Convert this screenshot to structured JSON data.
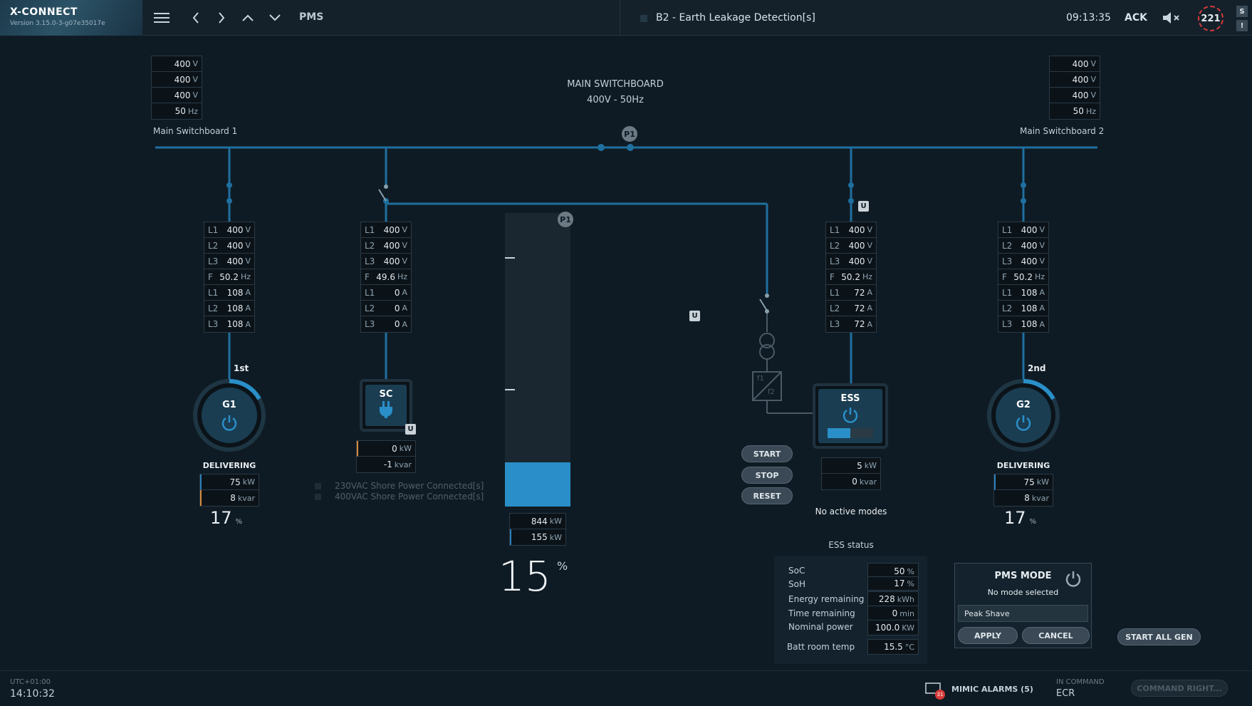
{
  "header": {
    "brand": "X-CONNECT",
    "version": "Version 3.15.0-3-g07e35017e",
    "page_title": "PMS",
    "alarm_text": "B2 - Earth Leakage Detection[s]",
    "alarm_time": "09:13:35",
    "ack_label": "ACK",
    "alarm_count": "221",
    "side_tags": [
      "S",
      "!"
    ]
  },
  "switchboard": {
    "title": "MAIN SWITCHBOARD",
    "subtitle": "400V - 50Hz",
    "left_label": "Main Switchboard 1",
    "right_label": "Main Switchboard 2",
    "bus_badge": "P1",
    "left_values": [
      [
        "400",
        "V"
      ],
      [
        "400",
        "V"
      ],
      [
        "400",
        "V"
      ],
      [
        "50",
        "Hz"
      ]
    ],
    "right_values": [
      [
        "400",
        "V"
      ],
      [
        "400",
        "V"
      ],
      [
        "400",
        "V"
      ],
      [
        "50",
        "Hz"
      ]
    ]
  },
  "g1": {
    "name": "G1",
    "rank": "1st",
    "state": "DELIVERING",
    "meas": [
      [
        "L1",
        "400",
        "V"
      ],
      [
        "L2",
        "400",
        "V"
      ],
      [
        "L3",
        "400",
        "V"
      ],
      [
        "F",
        "50.2",
        "Hz"
      ],
      [
        "L1",
        "108",
        "A"
      ],
      [
        "L2",
        "108",
        "A"
      ],
      [
        "L3",
        "108",
        "A"
      ]
    ],
    "kw": "75",
    "kvar": "8",
    "pct": "17",
    "kw_unit": "kW",
    "kvar_unit": "kvar",
    "pct_unit": "%",
    "load_fraction": 0.17
  },
  "sc": {
    "name": "SC",
    "badge": "U",
    "meas": [
      [
        "L1",
        "400",
        "V"
      ],
      [
        "L2",
        "400",
        "V"
      ],
      [
        "L3",
        "400",
        "V"
      ],
      [
        "F",
        "49.6",
        "Hz"
      ],
      [
        "L1",
        "0",
        "A"
      ],
      [
        "L2",
        "0",
        "A"
      ],
      [
        "L3",
        "0",
        "A"
      ]
    ],
    "kw": "0",
    "kvar": "-1",
    "kw_unit": "kW",
    "kvar_unit": "kvar",
    "shore_msgs": [
      "230VAC Shore Power Connected[s]",
      "400VAC Shore Power Connected[s]"
    ]
  },
  "load_bar": {
    "badge": "P1",
    "fill_fraction": 0.15,
    "available_kw": "844",
    "used_kw": "155",
    "unit": "kW",
    "pct": "15",
    "pct_unit": "%"
  },
  "ess": {
    "name": "ESS",
    "badge": "U",
    "transformer_badge": "U",
    "soc_fraction": 0.5,
    "meas": [
      [
        "L1",
        "400",
        "V"
      ],
      [
        "L2",
        "400",
        "V"
      ],
      [
        "L3",
        "400",
        "V"
      ],
      [
        "F",
        "50.2",
        "Hz"
      ],
      [
        "L1",
        "72",
        "A"
      ],
      [
        "L2",
        "72",
        "A"
      ],
      [
        "L3",
        "72",
        "A"
      ]
    ],
    "kw": "5",
    "kvar": "0",
    "kw_unit": "kW",
    "kvar_unit": "kvar",
    "modes": "No active modes",
    "buttons": {
      "start": "START",
      "stop": "STOP",
      "reset": "RESET"
    },
    "converter_labels": [
      "f1",
      "f2"
    ],
    "status_title": "ESS status",
    "status": [
      {
        "label": "SoC",
        "value": "50",
        "unit": "%"
      },
      {
        "label": "SoH",
        "value": "17",
        "unit": "%"
      },
      {
        "label": "Energy remaining",
        "value": "228",
        "unit": "kWh"
      },
      {
        "label": "Time remaining",
        "value": "0",
        "unit": "min"
      },
      {
        "label": "Nominal power",
        "value": "100.0",
        "unit": "KW"
      },
      {
        "label": "Batt room temp",
        "value": "15.5",
        "unit": "°C"
      }
    ]
  },
  "g2": {
    "name": "G2",
    "rank": "2nd",
    "state": "DELIVERING",
    "meas": [
      [
        "L1",
        "400",
        "V"
      ],
      [
        "L2",
        "400",
        "V"
      ],
      [
        "L3",
        "400",
        "V"
      ],
      [
        "F",
        "50.2",
        "Hz"
      ],
      [
        "L1",
        "108",
        "A"
      ],
      [
        "L2",
        "108",
        "A"
      ],
      [
        "L3",
        "108",
        "A"
      ]
    ],
    "kw": "75",
    "kvar": "8",
    "pct": "17",
    "kw_unit": "kW",
    "kvar_unit": "kvar",
    "pct_unit": "%",
    "load_fraction": 0.17
  },
  "pms_mode": {
    "title": "PMS MODE",
    "subtitle": "No mode selected",
    "selected": "Peak Shave",
    "apply": "APPLY",
    "cancel": "CANCEL"
  },
  "start_all_gen": "START ALL GEN",
  "footer": {
    "tz": "UTC+01:00",
    "clock": "14:10:32",
    "mimic_alarms": "MIMIC ALARMS (5)",
    "mimic_badge": "31",
    "in_command_label": "IN COMMAND",
    "in_command_value": "ECR",
    "command_right": "COMMAND RIGHT..."
  },
  "colors": {
    "bus": "#1f6f9f",
    "accent": "#2a8fc8",
    "alarm": "#d83a3a",
    "panel": "#13222d"
  }
}
